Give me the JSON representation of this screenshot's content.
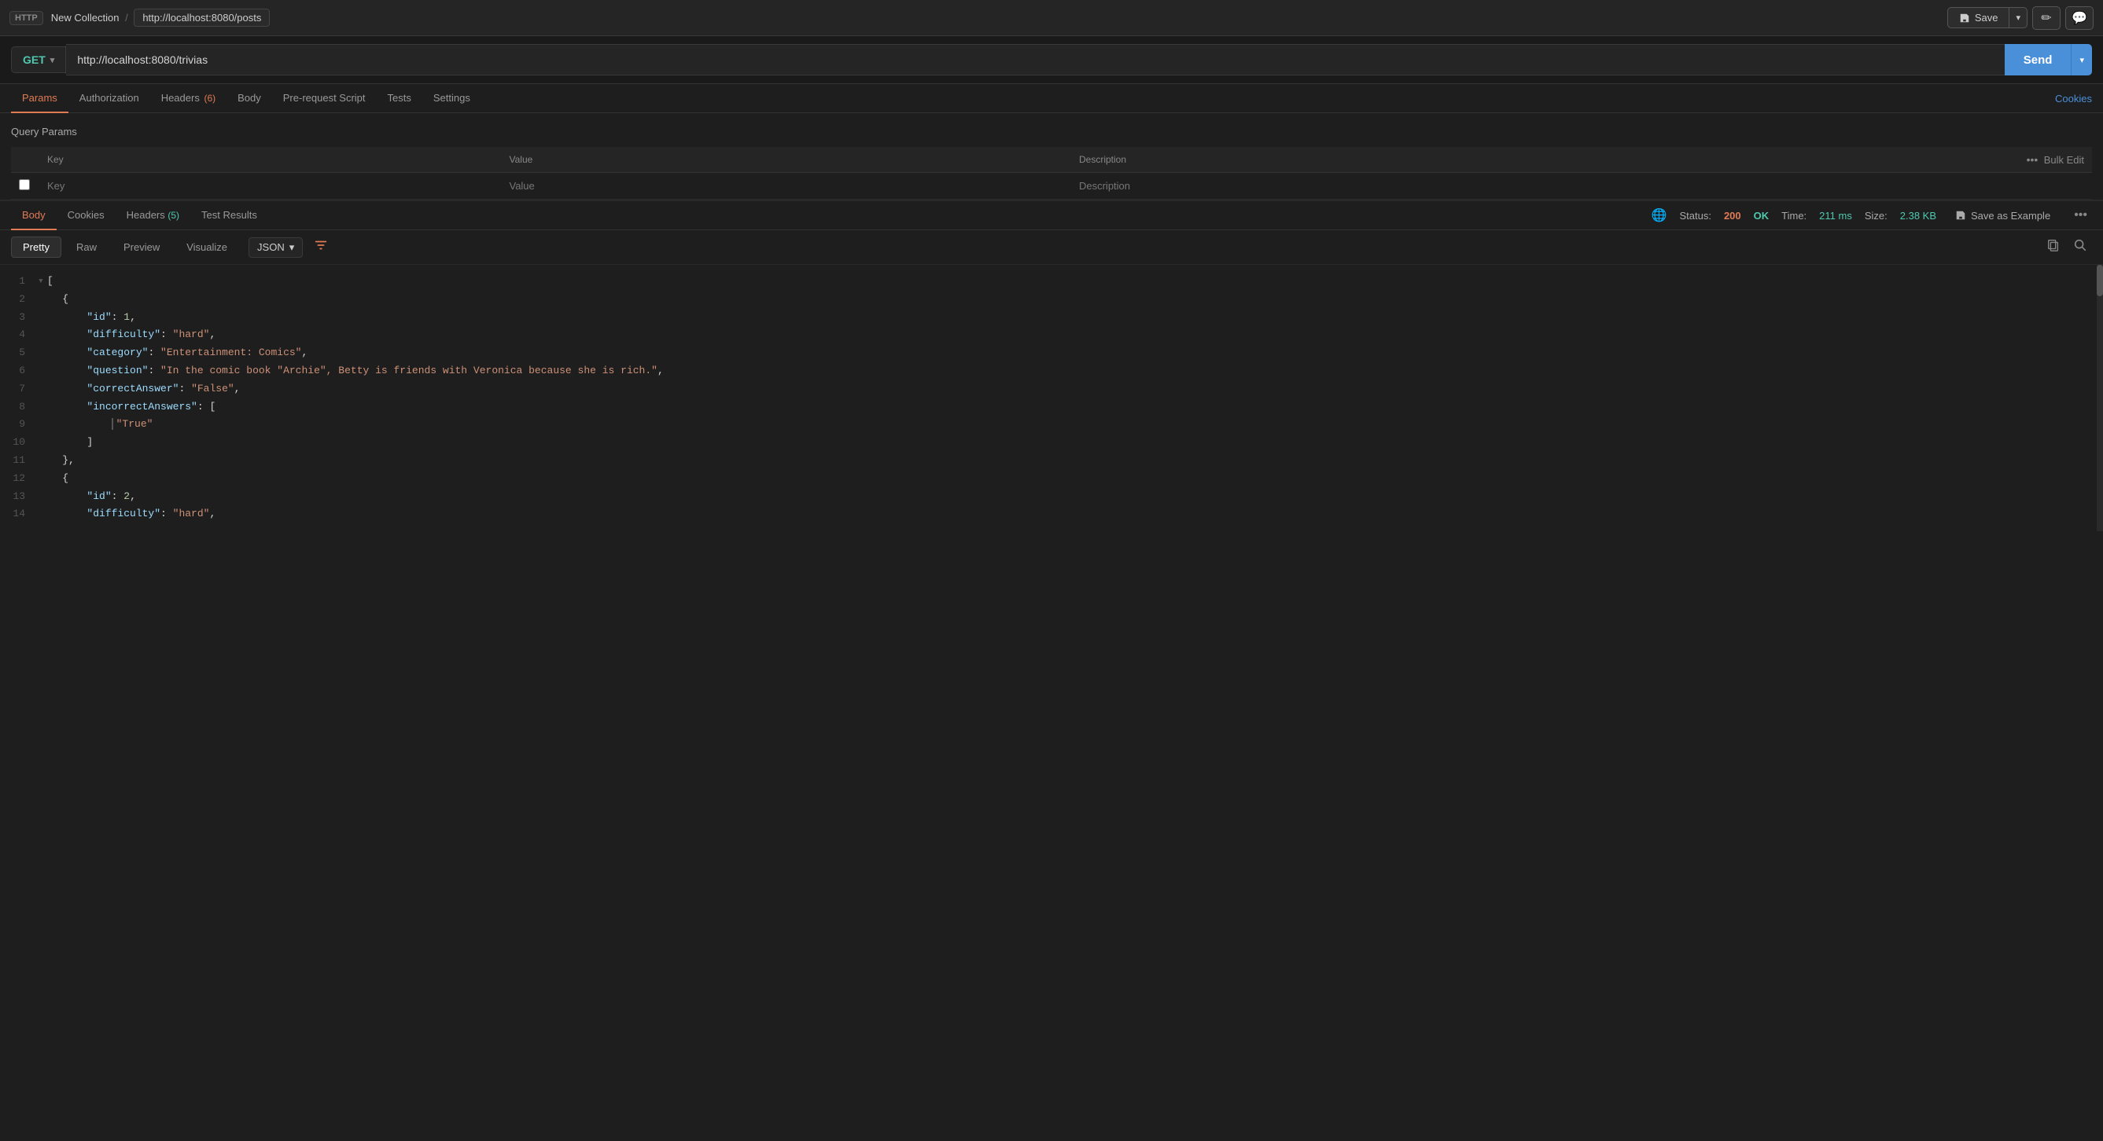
{
  "topbar": {
    "http_badge": "HTTP",
    "collection_name": "New Collection",
    "separator": "/",
    "collection_url": "http://localhost:8080/posts",
    "save_label": "Save",
    "edit_icon": "✏",
    "message_icon": "💬"
  },
  "urlbar": {
    "method": "GET",
    "url": "http://localhost:8080/trivias",
    "send_label": "Send"
  },
  "request_tabs": {
    "tabs": [
      {
        "label": "Params",
        "active": true,
        "badge": ""
      },
      {
        "label": "Authorization",
        "active": false,
        "badge": ""
      },
      {
        "label": "Headers",
        "active": false,
        "badge": "(6)"
      },
      {
        "label": "Body",
        "active": false,
        "badge": ""
      },
      {
        "label": "Pre-request Script",
        "active": false,
        "badge": ""
      },
      {
        "label": "Tests",
        "active": false,
        "badge": ""
      },
      {
        "label": "Settings",
        "active": false,
        "badge": ""
      }
    ],
    "cookies_label": "Cookies"
  },
  "query_params": {
    "title": "Query Params",
    "columns": [
      "Key",
      "Value",
      "Description"
    ],
    "bulk_edit_label": "Bulk Edit",
    "placeholder_key": "Key",
    "placeholder_value": "Value",
    "placeholder_desc": "Description"
  },
  "response_tabs": {
    "tabs": [
      {
        "label": "Body",
        "active": true,
        "badge": ""
      },
      {
        "label": "Cookies",
        "active": false,
        "badge": ""
      },
      {
        "label": "Headers",
        "active": false,
        "badge": "(5)"
      },
      {
        "label": "Test Results",
        "active": false,
        "badge": ""
      }
    ]
  },
  "response_status": {
    "status_label": "Status:",
    "status_code": "200",
    "status_text": "OK",
    "time_label": "Time:",
    "time_value": "211 ms",
    "size_label": "Size:",
    "size_value": "2.38 KB",
    "save_example_label": "Save as Example"
  },
  "view_controls": {
    "pretty_label": "Pretty",
    "raw_label": "Raw",
    "preview_label": "Preview",
    "visualize_label": "Visualize",
    "format_label": "JSON"
  },
  "json_lines": [
    {
      "num": 1,
      "content": "[",
      "type": "bracket"
    },
    {
      "num": 2,
      "content": "    {",
      "type": "bracket"
    },
    {
      "num": 3,
      "content": "        \"id\": 1,",
      "key": "id",
      "value": "1",
      "type": "number-pair"
    },
    {
      "num": 4,
      "content": "        \"difficulty\": \"hard\",",
      "key": "difficulty",
      "value": "\"hard\"",
      "type": "string-pair"
    },
    {
      "num": 5,
      "content": "        \"category\": \"Entertainment: Comics\",",
      "key": "category",
      "value": "\"Entertainment: Comics\"",
      "type": "string-pair"
    },
    {
      "num": 6,
      "content": "        \"question\": \"In the comic book &quot;Archie&quot;, Betty is friends with Veronica because she is rich.\",",
      "key": "question",
      "value": "\"In the comic book &quot;Archie&quot;, Betty is friends with Veronica because she is rich.\"",
      "type": "string-pair"
    },
    {
      "num": 7,
      "content": "        \"correctAnswer\": \"False\",",
      "key": "correctAnswer",
      "value": "\"False\"",
      "type": "string-pair"
    },
    {
      "num": 8,
      "content": "        \"incorrectAnswers\": [",
      "key": "incorrectAnswers",
      "type": "array-open"
    },
    {
      "num": 9,
      "content": "            \"True\"",
      "value": "\"True\"",
      "type": "array-string"
    },
    {
      "num": 10,
      "content": "        ]",
      "type": "bracket"
    },
    {
      "num": 11,
      "content": "    },",
      "type": "bracket"
    },
    {
      "num": 12,
      "content": "    {",
      "type": "bracket"
    },
    {
      "num": 13,
      "content": "        \"id\": 2,",
      "key": "id",
      "value": "2",
      "type": "number-pair"
    },
    {
      "num": 14,
      "content": "        \"difficulty\": \"hard\",",
      "key": "difficulty",
      "value": "\"hard\"",
      "type": "string-pair"
    }
  ]
}
